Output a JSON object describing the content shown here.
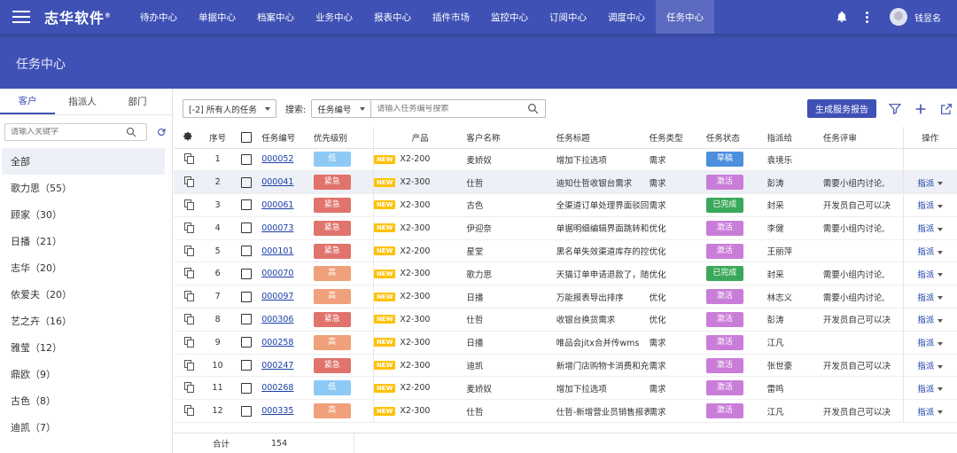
{
  "app": {
    "brand": "志华软件",
    "brand_mark": "®",
    "user_name": "钱昱名"
  },
  "nav": [
    "待办中心",
    "单据中心",
    "档案中心",
    "业务中心",
    "报表中心",
    "插件市场",
    "监控中心",
    "订阅中心",
    "调度中心",
    "任务中心"
  ],
  "nav_active_index": 9,
  "page_title": "任务中心",
  "sidebar": {
    "tabs": [
      "客户",
      "指派人",
      "部门"
    ],
    "active_tab": 0,
    "search_placeholder": "请输入关键字",
    "items": [
      "全部",
      "歌力思（55）",
      "顾家（30）",
      "日播（21）",
      "志华（20）",
      "依爱夫（20）",
      "艺之卉（16）",
      "雅莹（12）",
      "鼎欧（9）",
      "古色（8）",
      "迪凯（7）"
    ]
  },
  "toolbar": {
    "filter_value": "[-2] 所有人的任务",
    "search_label": "搜索:",
    "search_field": "任务编号",
    "search_placeholder": "请输入任务编号搜索",
    "report_button": "生成服务报告"
  },
  "table": {
    "headers": {
      "seq": "序号",
      "code": "任务编号",
      "priority": "优先级别",
      "product": "产品",
      "customer": "客户名称",
      "title": "任务标题",
      "type": "任务类型",
      "status": "任务状态",
      "assignee": "指派给",
      "review": "任务评审",
      "action": "操作"
    },
    "new_badge": "NEW",
    "action_label": "指派",
    "rows": [
      {
        "seq": "1",
        "code": "000052",
        "priority": "低",
        "product": "X2-200",
        "customer": "麦娇奴",
        "title": "增加下拉选项",
        "type": "需求",
        "status": "草稿",
        "assignee": "袁境乐",
        "review": "",
        "show_action": false
      },
      {
        "seq": "2",
        "code": "000041",
        "priority": "紧急",
        "product": "X2-300",
        "customer": "仕哲",
        "title": "迪知仕哲收银台需求",
        "type": "需求",
        "status": "激活",
        "assignee": "彭涛",
        "review": "需要小组内讨论,",
        "show_action": true
      },
      {
        "seq": "3",
        "code": "000061",
        "priority": "紧急",
        "product": "X2-300",
        "customer": "古色",
        "title": "全渠道订单处理界面驳回更改字段",
        "type": "需求",
        "status": "已完成",
        "assignee": "封采",
        "review": "开发员自己可以决",
        "show_action": true
      },
      {
        "seq": "4",
        "code": "000073",
        "priority": "紧急",
        "product": "X2-300",
        "customer": "伊迎奈",
        "title": "单据明细编辑界面跳转和显示优化",
        "type": "优化",
        "status": "激活",
        "assignee": "李健",
        "review": "需要小组内讨论,",
        "show_action": true
      },
      {
        "seq": "5",
        "code": "000101",
        "priority": "紧急",
        "product": "X2-200",
        "customer": "星堂",
        "title": "黑名单失效渠道库存的控制",
        "type": "优化",
        "status": "激活",
        "assignee": "王丽萍",
        "review": "",
        "show_action": true
      },
      {
        "seq": "6",
        "code": "000070",
        "priority": "高",
        "product": "X2-300",
        "customer": "歌力思",
        "title": "天猫订单申请退款了，随单赠品没有自动拦截",
        "type": "优化",
        "status": "已完成",
        "assignee": "封采",
        "review": "需要小组内讨论,",
        "show_action": true
      },
      {
        "seq": "7",
        "code": "000097",
        "priority": "高",
        "product": "X2-300",
        "customer": "日播",
        "title": "万能报表导出排序",
        "type": "优化",
        "status": "激活",
        "assignee": "林志义",
        "review": "需要小组内讨论,",
        "show_action": true
      },
      {
        "seq": "8",
        "code": "000306",
        "priority": "紧急",
        "product": "X2-300",
        "customer": "仕哲",
        "title": "收银台换货需求",
        "type": "优化",
        "status": "激活",
        "assignee": "彭涛",
        "review": "开发员自己可以决",
        "show_action": true
      },
      {
        "seq": "9",
        "code": "000258",
        "priority": "高",
        "product": "X2-300",
        "customer": "日播",
        "title": "唯品会jitx合并传wms",
        "type": "需求",
        "status": "激活",
        "assignee": "江凡",
        "review": "",
        "show_action": true
      },
      {
        "seq": "10",
        "code": "000247",
        "priority": "紧急",
        "product": "X2-300",
        "customer": "迪凯",
        "title": "新增门店购物卡消费和充值查询报表",
        "type": "需求",
        "status": "激活",
        "assignee": "张世豪",
        "review": "开发员自己可以决",
        "show_action": true
      },
      {
        "seq": "11",
        "code": "000268",
        "priority": "低",
        "product": "X2-200",
        "customer": "麦娇奴",
        "title": "增加下拉选项",
        "type": "需求",
        "status": "激活",
        "assignee": "雷鸣",
        "review": "",
        "show_action": true
      },
      {
        "seq": "12",
        "code": "000335",
        "priority": "高",
        "product": "X2-300",
        "customer": "仕哲",
        "title": "仕哲-新增营业员销售报表",
        "type": "需求",
        "status": "激活",
        "assignee": "江凡",
        "review": "开发员自己可以决",
        "show_action": true
      }
    ],
    "highlight_row": 1,
    "footer": {
      "label": "合计",
      "total": "154"
    }
  },
  "colors": {
    "primary": "#3f51b5",
    "priority": {
      "低": "#8ec9f5",
      "紧急": "#e0736c",
      "高": "#f0a07a"
    },
    "status": {
      "草稿": "#4b8fde",
      "激活": "#c97dd8",
      "已完成": "#3aa85a"
    }
  }
}
